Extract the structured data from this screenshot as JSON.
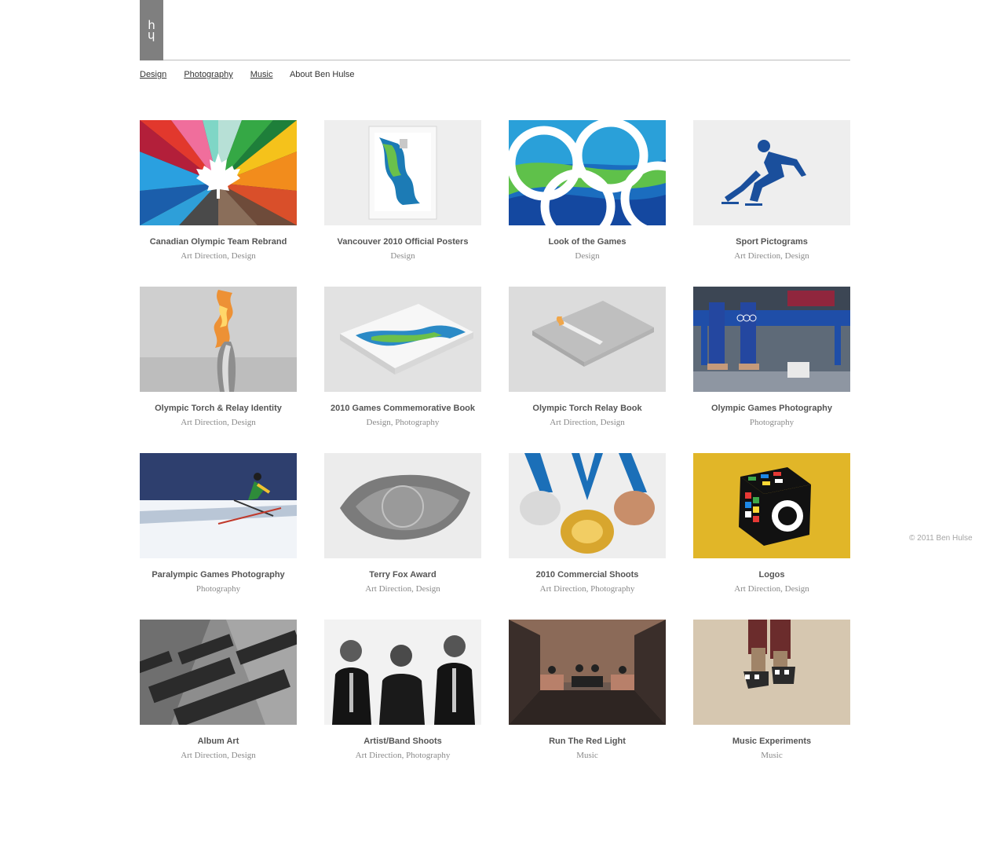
{
  "logo": {
    "top": "h",
    "bottom": "h"
  },
  "nav": {
    "items": [
      "Design",
      "Photography",
      "Music"
    ],
    "about": "About Ben Hulse"
  },
  "projects": [
    {
      "title": "Canadian Olympic Team Rebrand",
      "categories": "Art Direction, Design"
    },
    {
      "title": "Vancouver 2010 Official Posters",
      "categories": "Design"
    },
    {
      "title": "Look of the Games",
      "categories": "Design"
    },
    {
      "title": "Sport Pictograms",
      "categories": "Art Direction, Design"
    },
    {
      "title": "Olympic Torch & Relay Identity",
      "categories": "Art Direction, Design"
    },
    {
      "title": "2010 Games Commemorative Book",
      "categories": "Design, Photography"
    },
    {
      "title": "Olympic Torch Relay Book",
      "categories": "Art Direction, Design"
    },
    {
      "title": "Olympic Games Photography",
      "categories": "Photography"
    },
    {
      "title": "Paralympic Games Photography",
      "categories": "Photography"
    },
    {
      "title": "Terry Fox Award",
      "categories": "Art Direction, Design"
    },
    {
      "title": "2010 Commercial Shoots",
      "categories": "Art Direction, Photography"
    },
    {
      "title": "Logos",
      "categories": "Art Direction, Design"
    },
    {
      "title": "Album Art",
      "categories": "Art Direction, Design"
    },
    {
      "title": "Artist/Band Shoots",
      "categories": "Art Direction, Photography"
    },
    {
      "title": "Run The Red Light",
      "categories": "Music"
    },
    {
      "title": "Music Experiments",
      "categories": "Music"
    }
  ],
  "footer": {
    "copyright": "© 2011 Ben Hulse"
  },
  "colors": {
    "logo_bg": "#7f7f7f",
    "title": "#555555",
    "category": "#8a8a8a"
  }
}
